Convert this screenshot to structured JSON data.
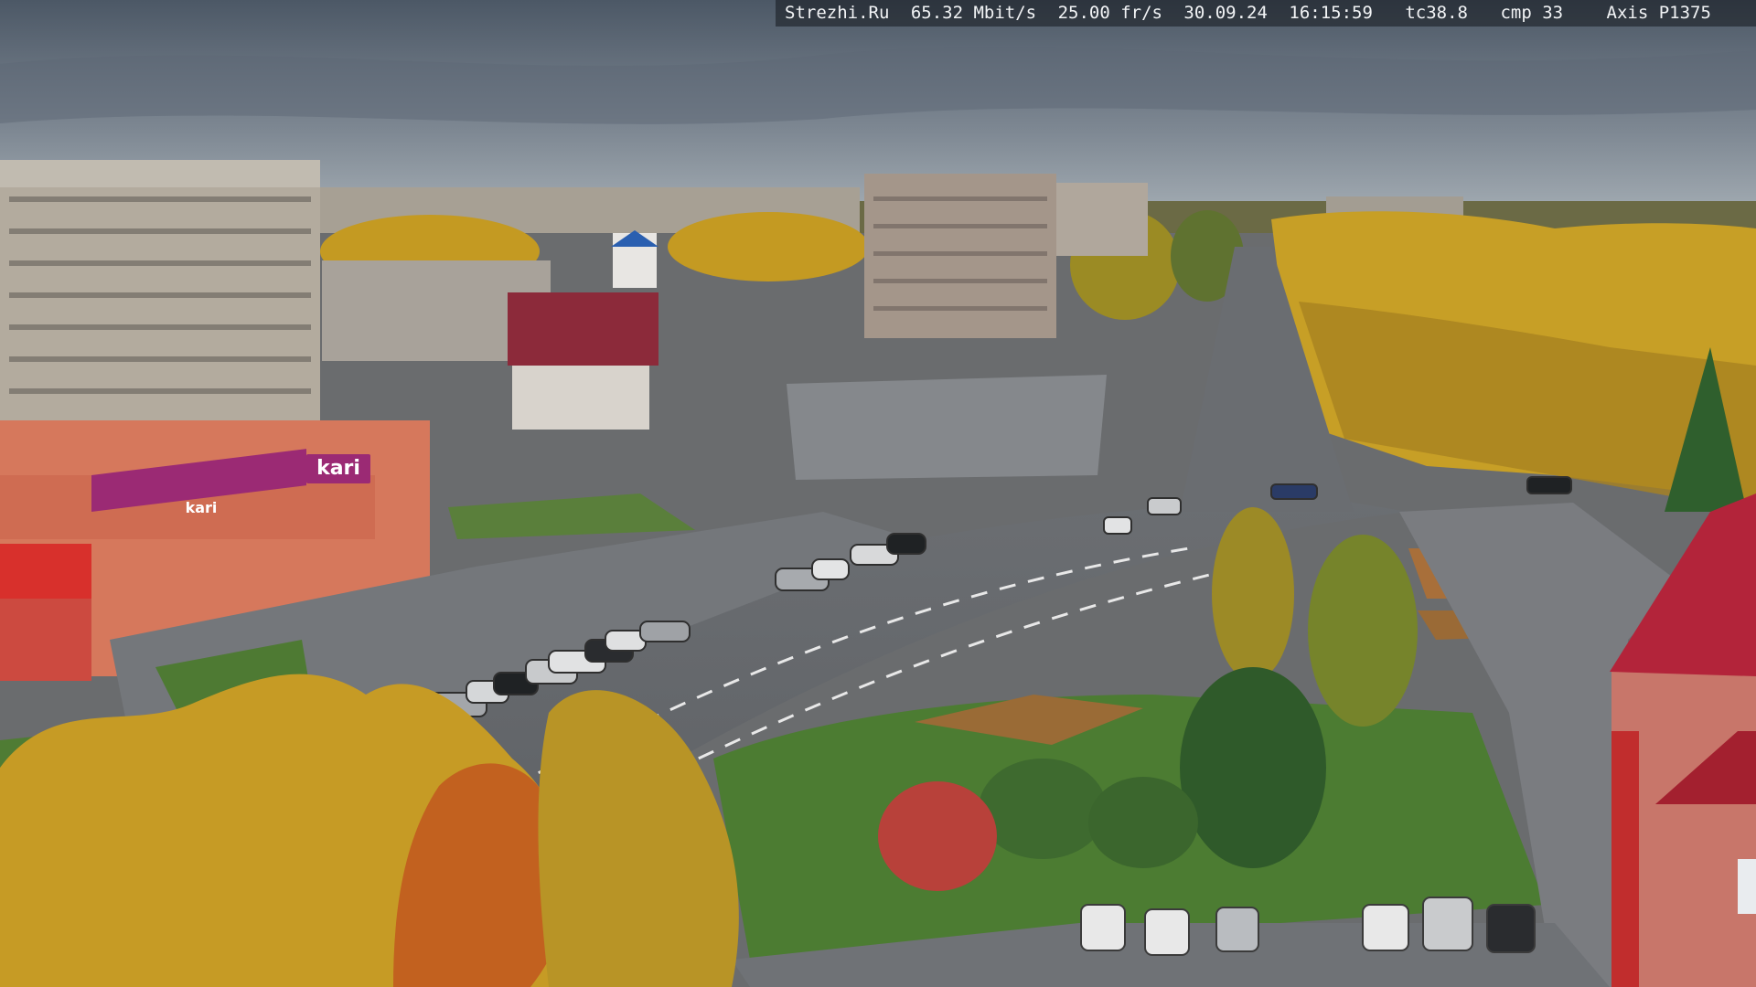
{
  "overlay": {
    "site": "Strezhi.Ru",
    "bitrate": "65.32 Mbit/s",
    "framerate": "25.00 fr/s",
    "date": "30.09.24",
    "time": "16:15:59",
    "tc": "tc38.8",
    "cmp": "cmp 33",
    "camera": "Axis P1375"
  },
  "signs": {
    "store_brand": "kari",
    "store_brand_small": "kari"
  },
  "colors": {
    "sky_top": "#4f5a68",
    "sky_bottom": "#9aa4ad",
    "asphalt": "#6d7074",
    "autumn_foliage": "#c9a024",
    "grass": "#4f7d34",
    "store_facade": "#d9775a",
    "store_sign": "#9b2a74",
    "roof_red": "#b3243a"
  }
}
